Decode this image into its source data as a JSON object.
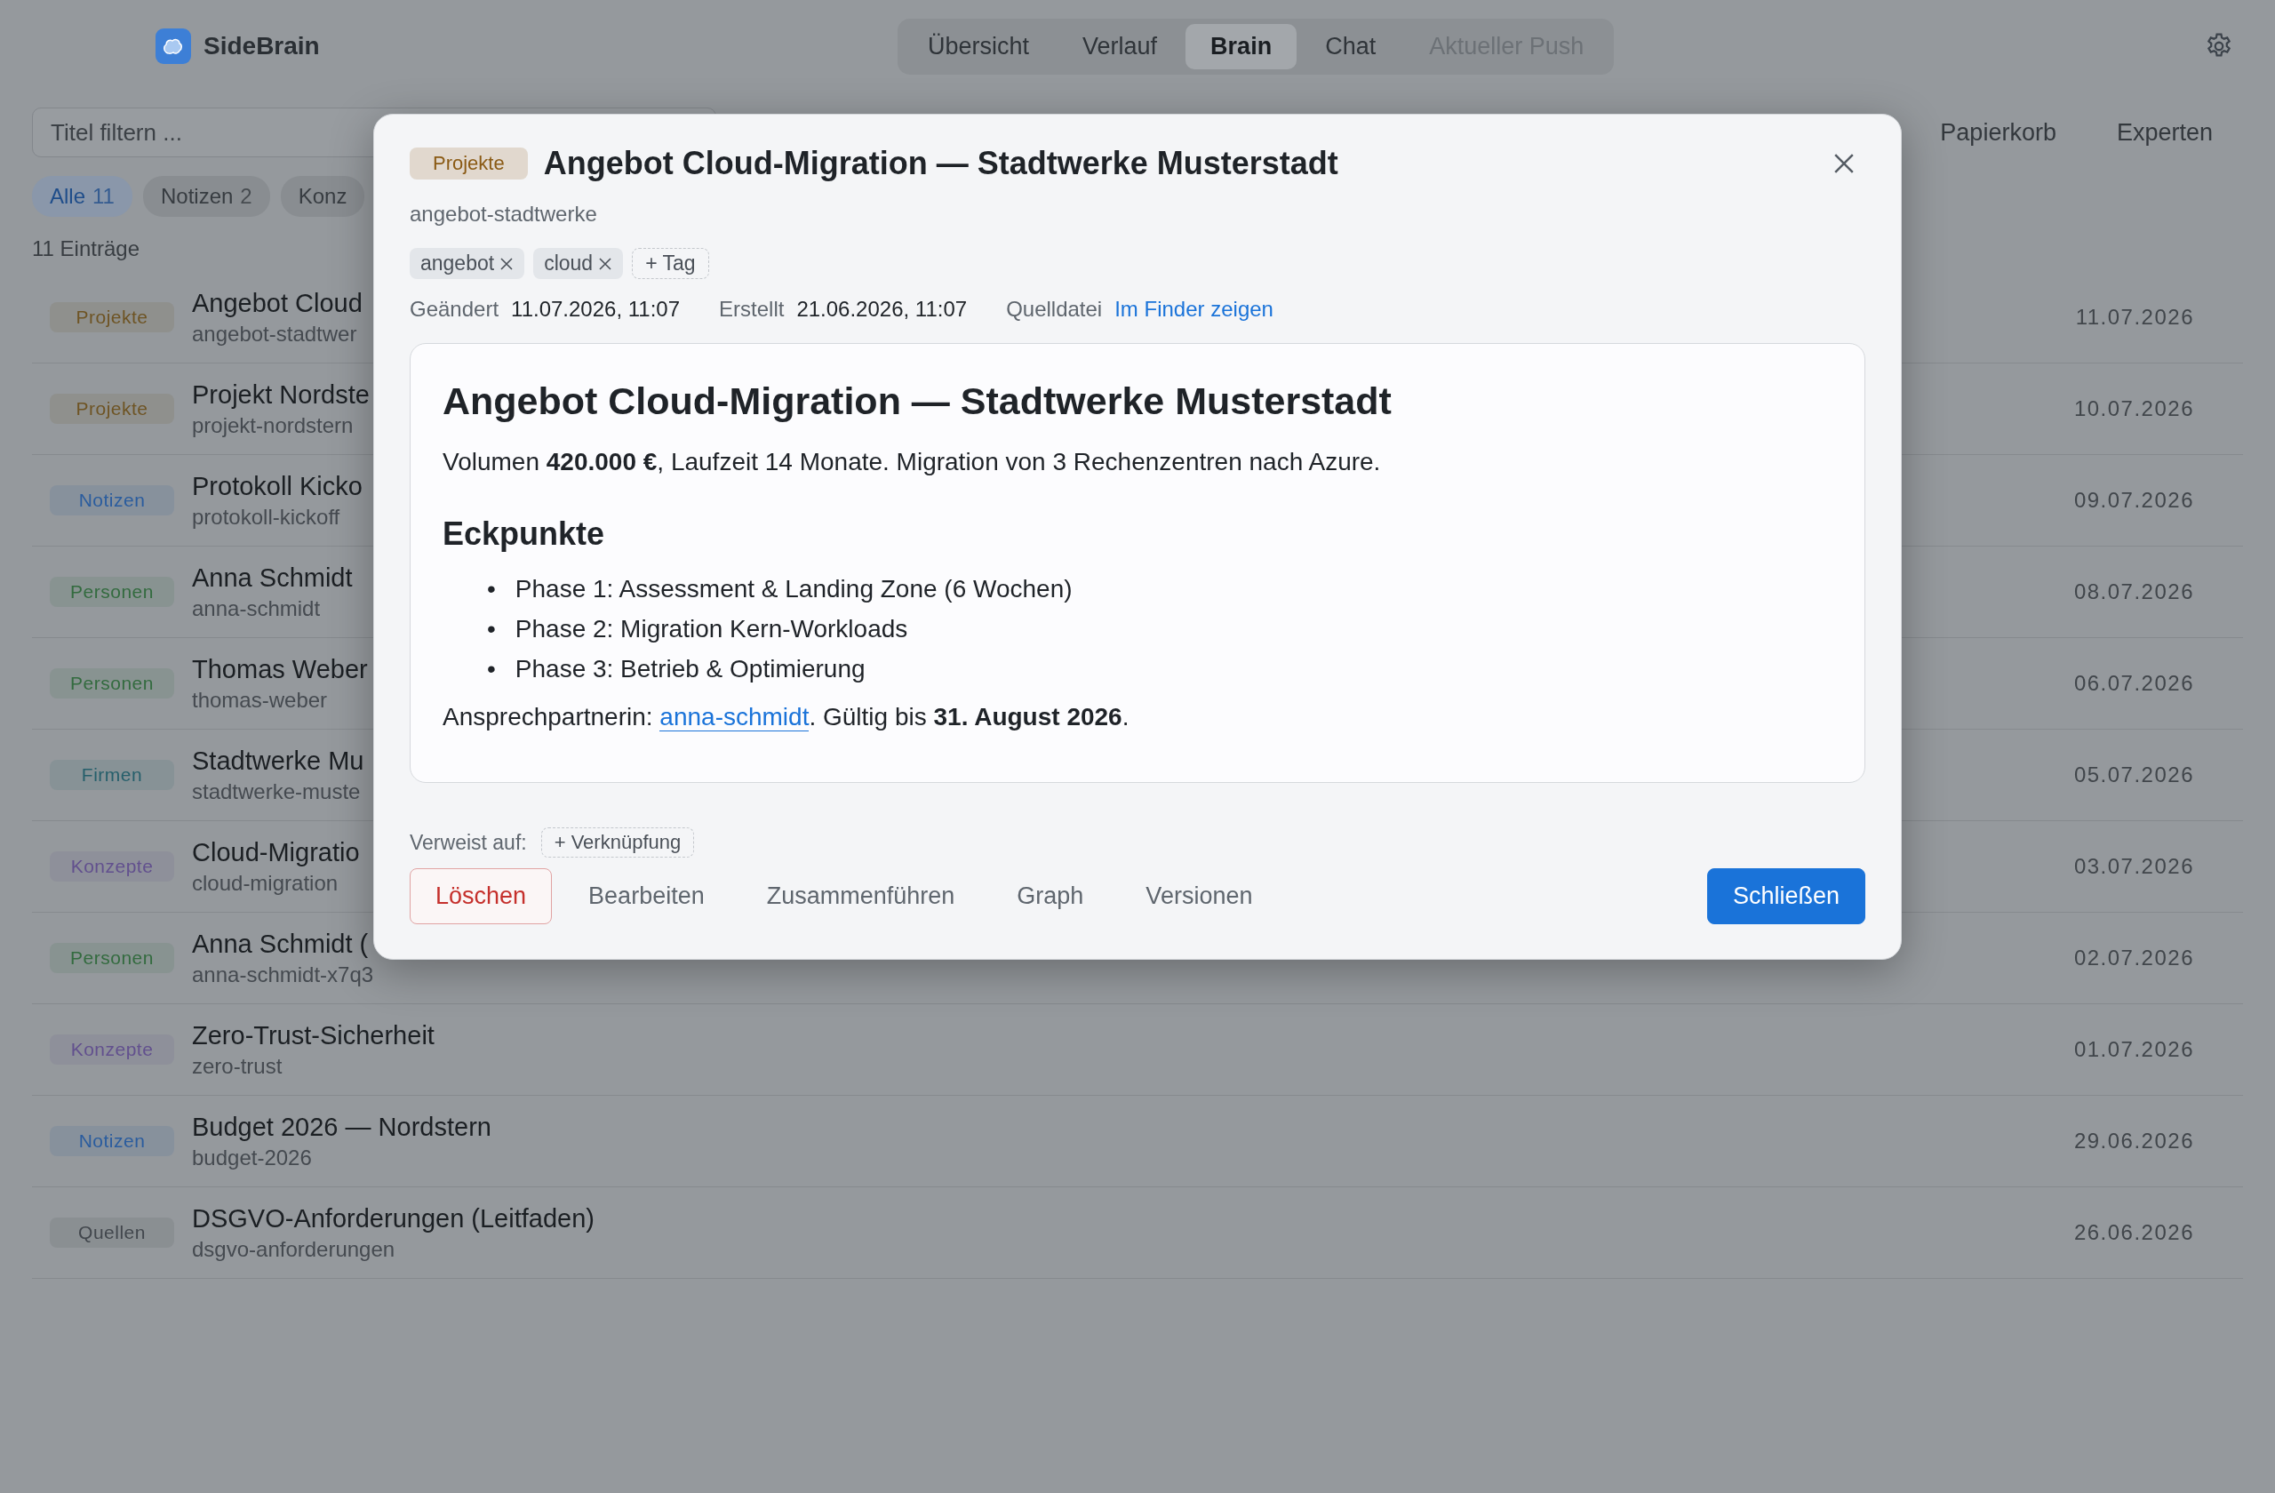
{
  "app": {
    "name": "SideBrain"
  },
  "tabs": [
    {
      "label": "Übersicht",
      "selected": false,
      "disabled": false
    },
    {
      "label": "Verlauf",
      "selected": false,
      "disabled": false
    },
    {
      "label": "Brain",
      "selected": true,
      "disabled": false
    },
    {
      "label": "Chat",
      "selected": false,
      "disabled": false
    },
    {
      "label": "Aktueller Push",
      "selected": false,
      "disabled": true
    }
  ],
  "toolbar": {
    "search": {
      "placeholder": "Titel filtern ..."
    },
    "buttons": [
      "Papierkorb",
      "Experten"
    ]
  },
  "filters": [
    {
      "label": "Alle",
      "count": "11",
      "selected": true
    },
    {
      "label": "Notizen",
      "count": "2",
      "selected": false
    },
    {
      "label": "Konz",
      "selected": false
    }
  ],
  "entry_count": "11 Einträge",
  "entries": [
    {
      "category": "Projekte",
      "color": "#6e5424",
      "title": "Angebot Cloud",
      "slug": "angebot-stadtwer",
      "date": "11.07.2026"
    },
    {
      "category": "Projekte",
      "color": "#6e5424",
      "title": "Projekt Nordste",
      "slug": "projekt-nordstern",
      "date": "10.07.2026"
    },
    {
      "category": "Notizen",
      "color": "#2a5c9e",
      "title": "Protokoll Kicko",
      "slug": "protokoll-kickoff",
      "date": "09.07.2026"
    },
    {
      "category": "Personen",
      "color": "#336b3f",
      "title": "Anna Schmidt",
      "slug": "anna-schmidt",
      "date": "08.07.2026"
    },
    {
      "category": "Personen",
      "color": "#336b3f",
      "title": "Thomas Weber",
      "slug": "thomas-weber",
      "date": "06.07.2026"
    },
    {
      "category": "Firmen",
      "color": "#265f6b",
      "title": "Stadtwerke Mu",
      "slug": "stadtwerke-muste",
      "date": "05.07.2026"
    },
    {
      "category": "Konzepte",
      "color": "#62508e",
      "title": "Cloud-Migratio",
      "slug": "cloud-migration",
      "date": "03.07.2026"
    },
    {
      "category": "Personen",
      "color": "#336b3f",
      "title": "Anna Schmidt (",
      "slug": "anna-schmidt-x7q3",
      "date": "02.07.2026"
    },
    {
      "category": "Konzepte",
      "color": "#62508e",
      "title": "Zero-Trust-Sicherheit",
      "slug": "zero-trust",
      "date": "01.07.2026"
    },
    {
      "category": "Notizen",
      "color": "#2a5c9e",
      "title": "Budget 2026 — Nordstern",
      "slug": "budget-2026",
      "date": "29.06.2026"
    },
    {
      "category": "Quellen",
      "color": "#42474d",
      "title": "DSGVO-Anforderungen (Leitfaden)",
      "slug": "dsgvo-anforderungen",
      "date": "26.06.2026"
    }
  ],
  "dialog": {
    "category": "Projekte",
    "color": "#8a5a14",
    "title": "Angebot Cloud-Migration — Stadtwerke Musterstadt",
    "slug": "angebot-stadtwerke",
    "tags": [
      "angebot",
      "cloud"
    ],
    "add_tag": "+ Tag",
    "meta": [
      {
        "label": "Geändert",
        "value": "11.07.2026, 11:07",
        "kind": "text"
      },
      {
        "label": "Erstellt",
        "value": "21.06.2026, 11:07",
        "kind": "text"
      },
      {
        "label": "Quelldatei",
        "value": "Im Finder zeigen",
        "kind": "link"
      }
    ],
    "content": {
      "heading": "Angebot Cloud-Migration — Stadtwerke Musterstadt",
      "intro": "Volumen **420.000 €**, Laufzeit 14 Monate. Migration von 3 Rechenzentren nach Azure.",
      "subheading": "Eckpunkte",
      "bullets": [
        {
          "marker": "•",
          "text": "Phase 1: Assessment & Landing Zone (6 Wochen)"
        },
        {
          "marker": "•",
          "text": "Phase 2: Migration Kern-Workloads"
        },
        {
          "marker": "•",
          "text": "Phase 3: Betrieb & Optimierung"
        }
      ],
      "contact": {
        "prefix": "Ansprechpartnerin: ",
        "link": "anna-schmidt",
        "suffix": ". Gültig bis **31. August 2026**."
      }
    },
    "links_label": "Verweist auf:",
    "add_link": "+ Verknüpfung",
    "actions": [
      {
        "label": "Löschen",
        "kind": "danger"
      },
      {
        "label": "Bearbeiten",
        "kind": "plain"
      },
      {
        "label": "Zusammenführen",
        "kind": "plain"
      },
      {
        "label": "Graph",
        "kind": "plain"
      },
      {
        "label": "Versionen",
        "kind": "plain"
      },
      {
        "label": "Schließen",
        "kind": "primary"
      }
    ]
  }
}
